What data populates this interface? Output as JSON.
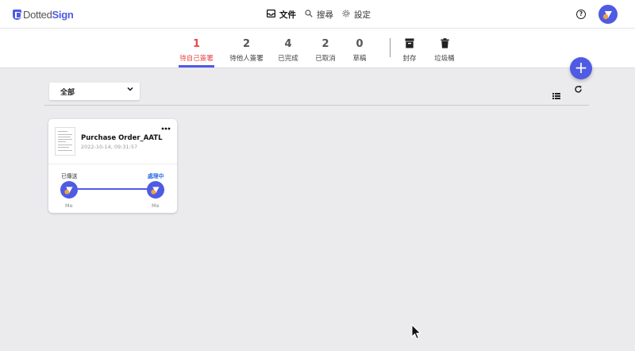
{
  "brand": {
    "name_a": "Dotted",
    "name_b": "Sign",
    "color": "#4f5be3"
  },
  "topnav": [
    {
      "label": "文件",
      "icon": "inbox-icon",
      "active": true
    },
    {
      "label": "搜尋",
      "icon": "search-icon",
      "active": false
    },
    {
      "label": "設定",
      "icon": "gear-icon",
      "active": false
    }
  ],
  "help": {
    "glyph": "?"
  },
  "tabs": [
    {
      "count": "1",
      "label": "待自己簽署",
      "active": true
    },
    {
      "count": "2",
      "label": "待他人簽署"
    },
    {
      "count": "4",
      "label": "已完成"
    },
    {
      "count": "2",
      "label": "已取消"
    },
    {
      "count": "0",
      "label": "草稿"
    }
  ],
  "actions": [
    {
      "label": "封存",
      "icon": "archive-icon"
    },
    {
      "label": "垃圾桶",
      "icon": "trash-icon"
    }
  ],
  "fab": {
    "glyph": "+"
  },
  "filter": {
    "value": "全部"
  },
  "document": {
    "name": "Purchase Order_AATL",
    "time": "2022-10-14, 09:31:57",
    "status_from": "已傳送",
    "status_to": "處理中",
    "from_user": "Me",
    "to_user": "Me"
  },
  "colors": {
    "accent": "#4f5be3",
    "active_tab": "#e54b4b",
    "status_link": "#2a6ee8",
    "avatar_dot": "#f0a340"
  }
}
